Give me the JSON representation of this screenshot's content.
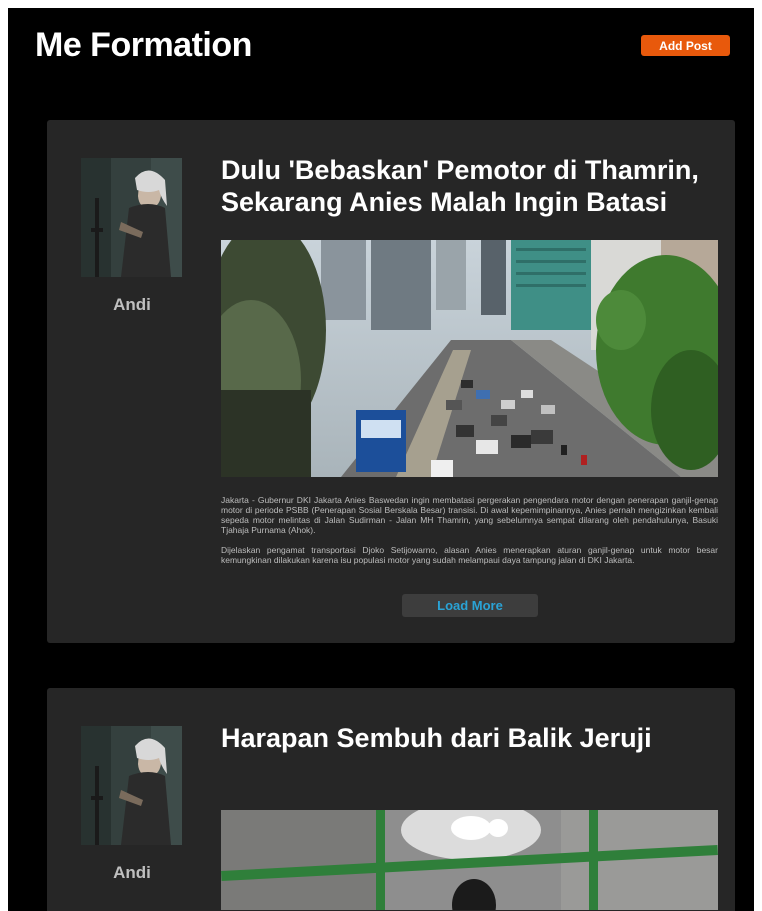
{
  "header": {
    "brand": "Me Formation",
    "add_post_label": "Add Post",
    "add_post_color": "#e8590c"
  },
  "posts": [
    {
      "author": "Andi",
      "title": "Dulu 'Bebaskan' Pemotor di Thamrin, Sekarang Anies Malah Ingin Batasi",
      "paragraphs": [
        "Jakarta - Gubernur DKI Jakarta Anies Baswedan ingin membatasi pergerakan pengendara motor dengan penerapan ganjil-genap motor di periode PSBB (Penerapan Sosial Berskala Besar) transisi. Di awal kepemimpinannya, Anies pernah mengizinkan kembali sepeda motor melintas di Jalan Sudirman - Jalan MH Thamrin, yang sebelumnya sempat dilarang oleh pendahulunya, Basuki Tjahaja Purnama (Ahok).",
        "Dijelaskan pengamat transportasi Djoko Setijowarno, alasan Anies menerapkan aturan ganjil-genap untuk motor besar kemungkinan dilakukan karena isu populasi motor yang sudah melampaui daya tampung jalan di DKI Jakarta."
      ],
      "load_more_label": "Load More"
    },
    {
      "author": "Andi",
      "title": "Harapan Sembuh dari Balik Jeruji"
    }
  ],
  "colors": {
    "background": "#000000",
    "card": "#262626",
    "accent": "#e8590c",
    "link": "#2aa3d6"
  }
}
